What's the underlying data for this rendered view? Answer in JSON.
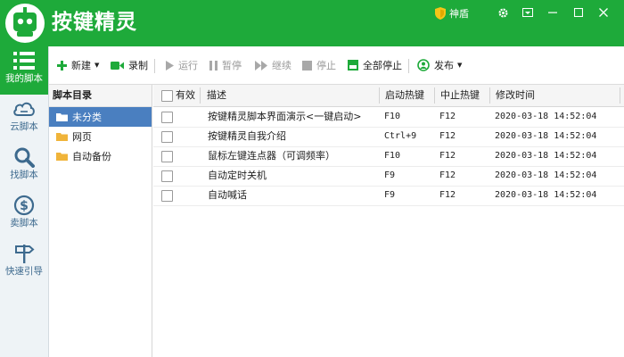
{
  "app": {
    "title": "按键精灵",
    "vip_label": "神盾"
  },
  "colors": {
    "brand_green": "#1eaa3a",
    "selection_blue": "#4a7fc0",
    "sidebar_text": "#3d6a8e"
  },
  "window_controls": [
    "gear-icon",
    "menu-icon",
    "minimize-icon",
    "maximize-icon",
    "close-icon"
  ],
  "sidebar": {
    "items": [
      {
        "label": "我的脚本",
        "icon": "list-icon",
        "active": true
      },
      {
        "label": "云脚本",
        "icon": "cloud-icon",
        "active": false
      },
      {
        "label": "找脚本",
        "icon": "search-icon",
        "active": false
      },
      {
        "label": "卖脚本",
        "icon": "dollar-icon",
        "active": false
      },
      {
        "label": "快速引导",
        "icon": "signpost-icon",
        "active": false
      }
    ]
  },
  "toolbar": {
    "new": "新建",
    "record": "录制",
    "run": "运行",
    "pause": "暂停",
    "continue": "继续",
    "stop": "停止",
    "stop_all": "全部停止",
    "publish": "发布"
  },
  "tree": {
    "header": "脚本目录",
    "items": [
      "未分类",
      "网页",
      "自动备份"
    ]
  },
  "table": {
    "columns": {
      "valid": "有效",
      "desc": "描述",
      "start_hotkey": "启动热键",
      "stop_hotkey": "中止热键",
      "modified": "修改时间"
    },
    "rows": [
      {
        "desc": "按键精灵脚本界面演示<一键启动>",
        "start": "F10",
        "stop": "F12",
        "time": "2020-03-18 14:52:04"
      },
      {
        "desc": "按键精灵自我介绍",
        "start": "Ctrl+9",
        "stop": "F12",
        "time": "2020-03-18 14:52:04"
      },
      {
        "desc": "鼠标左键连点器（可调频率）",
        "start": "F10",
        "stop": "F12",
        "time": "2020-03-18 14:52:04"
      },
      {
        "desc": "自动定时关机",
        "start": "F9",
        "stop": "F12",
        "time": "2020-03-18 14:52:04"
      },
      {
        "desc": "自动喊话",
        "start": "F9",
        "stop": "F12",
        "time": "2020-03-18 14:52:04"
      }
    ]
  }
}
